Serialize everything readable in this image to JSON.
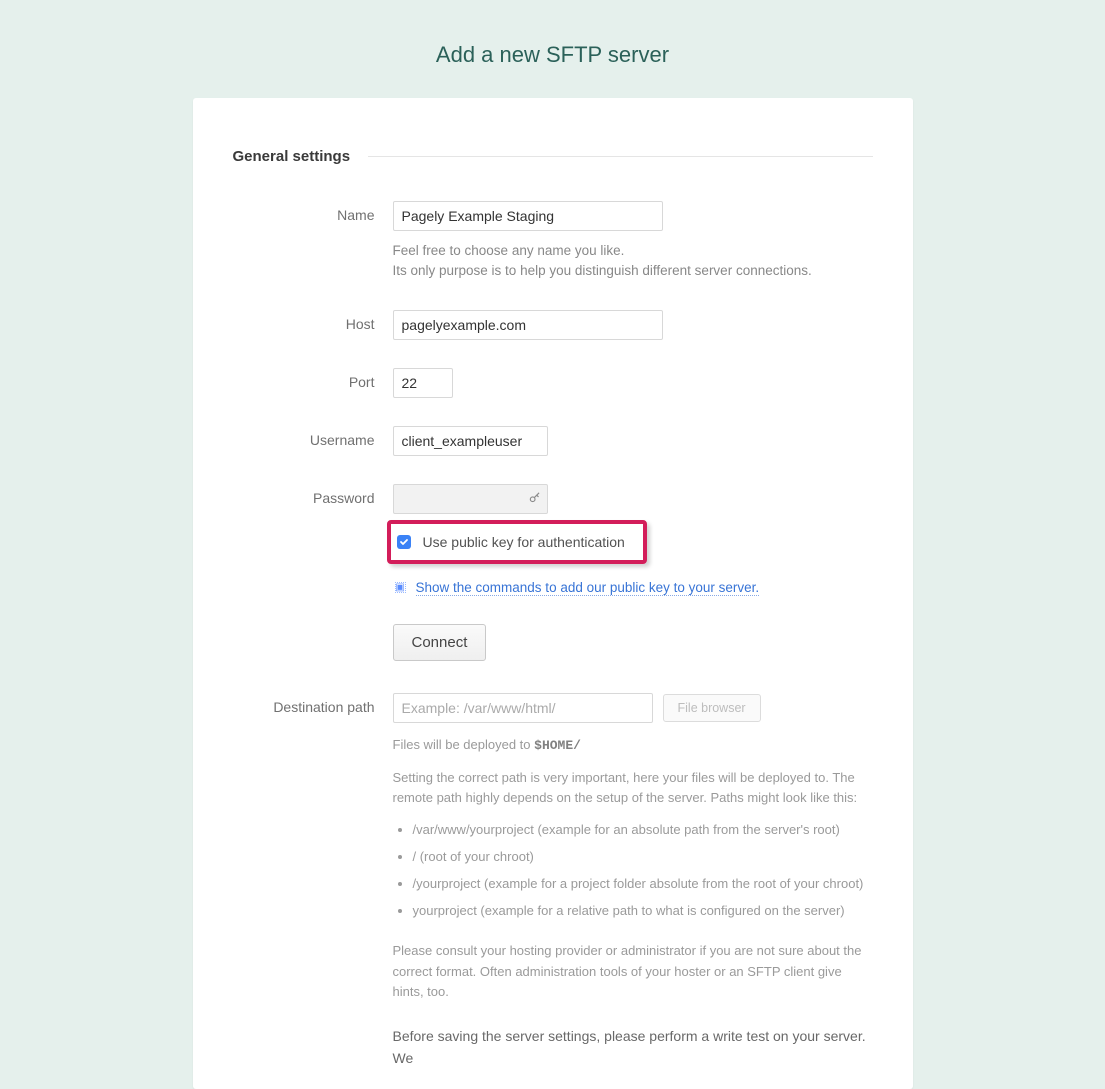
{
  "page": {
    "title": "Add a new SFTP server"
  },
  "section": {
    "general": "General settings"
  },
  "fields": {
    "name": {
      "label": "Name",
      "value": "Pagely Example Staging",
      "help1": "Feel free to choose any name you like.",
      "help2": "Its only purpose is to help you distinguish different server connections."
    },
    "host": {
      "label": "Host",
      "value": "pagelyexample.com"
    },
    "port": {
      "label": "Port",
      "value": "22"
    },
    "username": {
      "label": "Username",
      "value": "client_exampleuser"
    },
    "password": {
      "label": "Password",
      "value": "",
      "pubkey_label": "Use public key for authentication",
      "show_commands_link": "Show the commands to add our public key to your server."
    },
    "connect_button": "Connect",
    "destination": {
      "label": "Destination path",
      "placeholder": "Example: /var/www/html/",
      "file_browser": "File browser",
      "deployed_prefix": "Files will be deployed to ",
      "deployed_path": "$HOME/",
      "help1": "Setting the correct path is very important, here your files will be deployed to. The remote path highly depends on the setup of the server. Paths might look like this:",
      "examples": [
        "/var/www/yourproject (example for an absolute path from the server's root)",
        "/ (root of your chroot)",
        "/yourproject (example for a project folder absolute from the root of your chroot)",
        "yourproject (example for a relative path to what is configured on the server)"
      ],
      "help2": "Please consult your hosting provider or administrator if you are not sure about the correct format. Often administration tools of your hoster or an SFTP client give hints, too.",
      "help3": "Before saving the server settings, please perform a write test on your server. We"
    }
  }
}
